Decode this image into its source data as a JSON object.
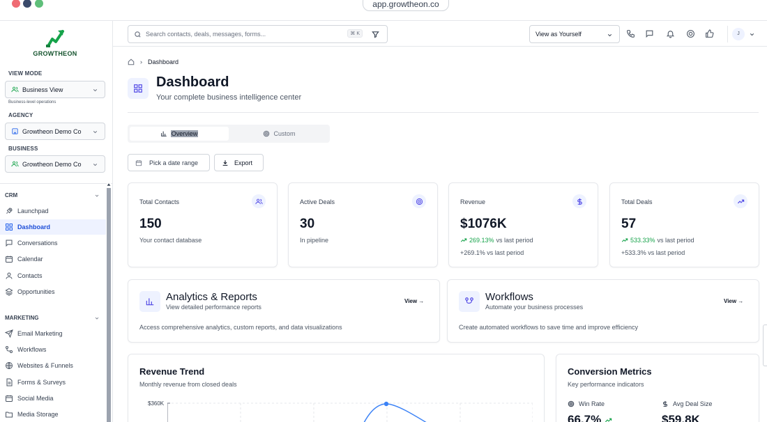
{
  "browser": {
    "url": "app.growtheon.co"
  },
  "brand": {
    "name": "GROWTHEON",
    "accent": "#16a34a"
  },
  "sidebar": {
    "view_mode_label": "VIEW MODE",
    "view_mode_value": "Business View",
    "view_mode_hint": "Business-level operations",
    "agency_label": "AGENCY",
    "agency_value": "Growtheon Demo Co",
    "business_label": "BUSINESS",
    "business_value": "Growtheon Demo Co",
    "crm_label": "CRM",
    "crm_items": [
      {
        "label": "Launchpad",
        "icon": "rocket-icon"
      },
      {
        "label": "Dashboard",
        "icon": "dashboard-icon",
        "active": true
      },
      {
        "label": "Conversations",
        "icon": "chat-icon"
      },
      {
        "label": "Calendar",
        "icon": "calendar-icon"
      },
      {
        "label": "Contacts",
        "icon": "contacts-icon"
      },
      {
        "label": "Opportunities",
        "icon": "layers-icon"
      }
    ],
    "marketing_label": "MARKETING",
    "marketing_items": [
      {
        "label": "Email Marketing",
        "icon": "send-icon"
      },
      {
        "label": "Workflows",
        "icon": "workflow-icon"
      },
      {
        "label": "Websites & Funnels",
        "icon": "globe-icon"
      },
      {
        "label": "Forms & Surveys",
        "icon": "form-icon"
      },
      {
        "label": "Social Media",
        "icon": "calendar-icon"
      },
      {
        "label": "Media Storage",
        "icon": "folder-icon"
      }
    ]
  },
  "header": {
    "search_placeholder": "Search contacts, deals, messages, forms...",
    "kbd": "⌘ K",
    "view_as": "View as Yourself",
    "avatar": "J"
  },
  "breadcrumb": {
    "current": "Dashboard"
  },
  "page": {
    "title": "Dashboard",
    "subtitle": "Your complete business intelligence center"
  },
  "tabs": [
    {
      "label": "Overview",
      "active": true
    },
    {
      "label": "Custom",
      "active": false
    }
  ],
  "actions": {
    "date_range": "Pick a date range",
    "export": "Export"
  },
  "stats": [
    {
      "title": "Total Contacts",
      "value": "150",
      "sub": "Your contact database",
      "icon": "users-icon"
    },
    {
      "title": "Active Deals",
      "value": "30",
      "sub": "In pipeline",
      "icon": "target-icon"
    },
    {
      "title": "Revenue",
      "value": "$1076K",
      "trend_pct": "269.13%",
      "trend_text": "vs last period",
      "sub2": "+269.1% vs last period",
      "icon": "dollar-icon"
    },
    {
      "title": "Total Deals",
      "value": "57",
      "trend_pct": "533.33%",
      "trend_text": "vs last period",
      "sub2": "+533.3% vs last period",
      "icon": "trend-icon"
    }
  ],
  "feature_cards": [
    {
      "title": "Analytics & Reports",
      "sub": "View detailed performance reports",
      "view": "View →",
      "desc": "Access comprehensive analytics, custom reports, and data visualizations",
      "icon": "bar-chart-icon"
    },
    {
      "title": "Workflows",
      "sub": "Automate your business processes",
      "view": "View →",
      "desc": "Create automated workflows to save time and improve efficiency",
      "icon": "workflow-icon"
    }
  ],
  "revenue_trend": {
    "title": "Revenue Trend",
    "sub": "Monthly revenue from closed deals",
    "ytick": "$360K"
  },
  "conversion": {
    "title": "Conversion Metrics",
    "sub": "Key performance indicators",
    "win_rate_label": "Win Rate",
    "win_rate_value": "66.7%",
    "avg_deal_label": "Avg Deal Size",
    "avg_deal_value": "$59.8K"
  }
}
